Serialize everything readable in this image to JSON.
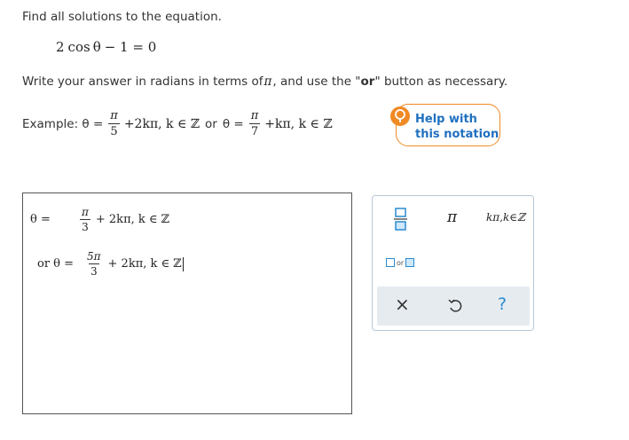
{
  "question": {
    "instruction": "Find all solutions to the equation.",
    "equation": {
      "coef": "2",
      "func": "cos",
      "var": "θ",
      "rest": "− 1 = 0"
    },
    "direction_prefix": "Write your answer in radians in terms of ",
    "direction_pi": "π",
    "direction_mid": ", and use the \"",
    "direction_or": "or",
    "direction_suffix": "\" button as necessary."
  },
  "example": {
    "label": "Example: θ =",
    "frac1_num": "π",
    "frac1_den": "5",
    "part1": "+2kπ, k ∈ ℤ",
    "or_text": "or",
    "theta_eq": "θ =",
    "frac2_num": "π",
    "frac2_den": "7",
    "part2": "+kπ, k ∈ ℤ"
  },
  "help": {
    "line1": "Help with",
    "line2": "this notation"
  },
  "answer": {
    "line1_lhs": "θ =",
    "line1_num": "π",
    "line1_den": "3",
    "line1_rest": "+ 2kπ, k ∈ ℤ",
    "line2_lhs": "or θ =",
    "line2_num": "5π",
    "line2_den": "3",
    "line2_rest": "+ 2kπ, k ∈ ℤ"
  },
  "palette": {
    "pi_label": "π",
    "kpi_label": "kπ,k∈ℤ",
    "or_label": "or",
    "clear_label": "×",
    "undo_icon": "undo-icon",
    "help_label": "?"
  },
  "colors": {
    "accent_orange": "#f08a24",
    "link_blue": "#2070c0",
    "palette_blue": "#2a8ad0"
  }
}
